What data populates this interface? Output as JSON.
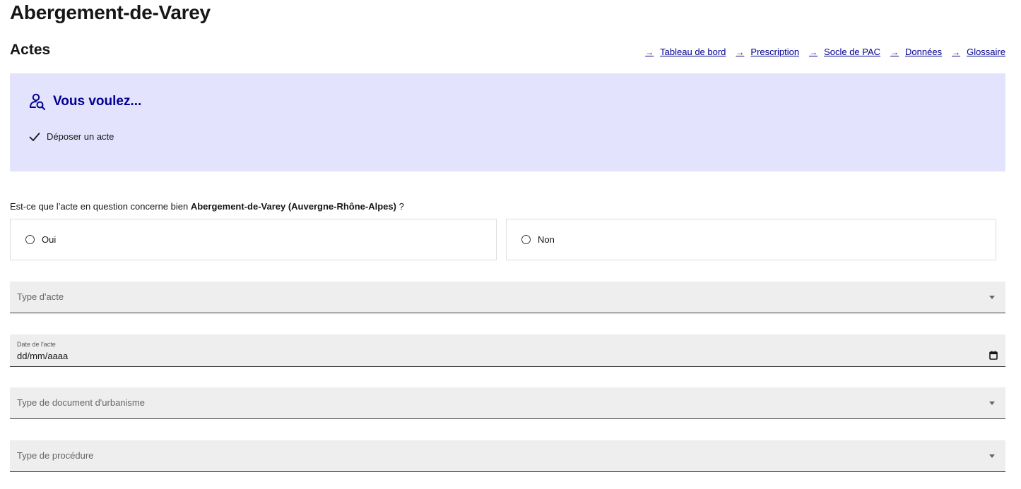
{
  "header": {
    "city_name": "Abergement-de-Varey",
    "section_title": "Actes"
  },
  "nav": {
    "items": [
      {
        "label": "Tableau de bord",
        "icon": "arrow-right-icon"
      },
      {
        "label": "Prescription",
        "icon": "arrow-right-icon"
      },
      {
        "label": "Socle de PAC",
        "icon": "arrow-right-icon"
      },
      {
        "label": "Données",
        "icon": "arrow-right-icon"
      },
      {
        "label": "Glossaire",
        "icon": "arrow-right-icon"
      }
    ]
  },
  "callout": {
    "title": "Vous voulez...",
    "icon": "user-search-icon",
    "item": "Déposer un acte",
    "item_icon": "check-icon",
    "background": "#e3e3fd",
    "accent": "#000091"
  },
  "question": {
    "prefix": "Est-ce que l’acte en question concerne bien ",
    "place": "Abergement-de-Varey (Auvergne-Rhône-Alpes)",
    "suffix": " ?",
    "options": [
      "Oui",
      "Non"
    ]
  },
  "form": {
    "type_acte_placeholder": "Type d'acte",
    "date_label": "Date de l'acte",
    "date_value": "dd/mm/aaaa",
    "type_document_placeholder": "Type de document d'urbanisme",
    "type_procedure_placeholder": "Type de procédure"
  }
}
